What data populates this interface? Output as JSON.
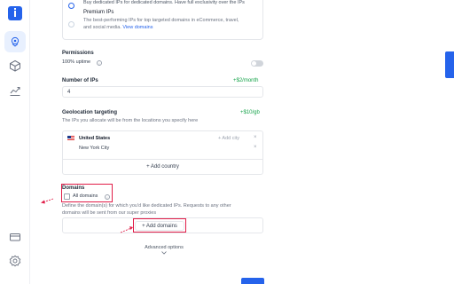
{
  "sidebar": {
    "logo_icon": "app-logo",
    "items": [
      {
        "icon": "location-pin-icon",
        "active": true
      },
      {
        "icon": "cube-icon",
        "active": false
      },
      {
        "icon": "trend-chart-icon",
        "active": false
      }
    ],
    "bottom_items": [
      {
        "icon": "credit-card-icon"
      },
      {
        "icon": "settings-gear-icon"
      }
    ]
  },
  "plan_options": {
    "dedicated": {
      "description": "Buy dedicated IPs for dedicated domains. Have full exclusivity over the IPs"
    },
    "premium": {
      "title": "Premium IPs",
      "description_line1": "The best-performing IPs for top targeted domains in eCommerce, travel,",
      "description_line2": "and social media.",
      "link": "View domains"
    }
  },
  "permissions": {
    "label": "Permissions",
    "uptime_label": "100% uptime",
    "toggle_on": false
  },
  "num_ips": {
    "label": "Number of IPs",
    "price": "+$2/month",
    "value": "4"
  },
  "geolocation": {
    "label": "Geolocation targeting",
    "price": "+$10/gb",
    "description": "The IPs you allocate will be from the locations you specify here",
    "country": "United States",
    "city": "New York City",
    "add_city": "+ Add city",
    "add_country": "+ Add country"
  },
  "domains": {
    "label": "Domains",
    "all_domains": "All domains",
    "all_domains_checked": false,
    "description_line1": "Define the domain(s) for which you'd like dedicated IPs. Requests to any other",
    "description_line2": "domains will be sent from our super proxies",
    "add_domains": "+ Add domains"
  },
  "advanced_options": "Advanced options",
  "annotations": {
    "highlight_color": "#e11d48"
  },
  "colors": {
    "accent": "#2563eb",
    "price_green": "#16a34a"
  }
}
